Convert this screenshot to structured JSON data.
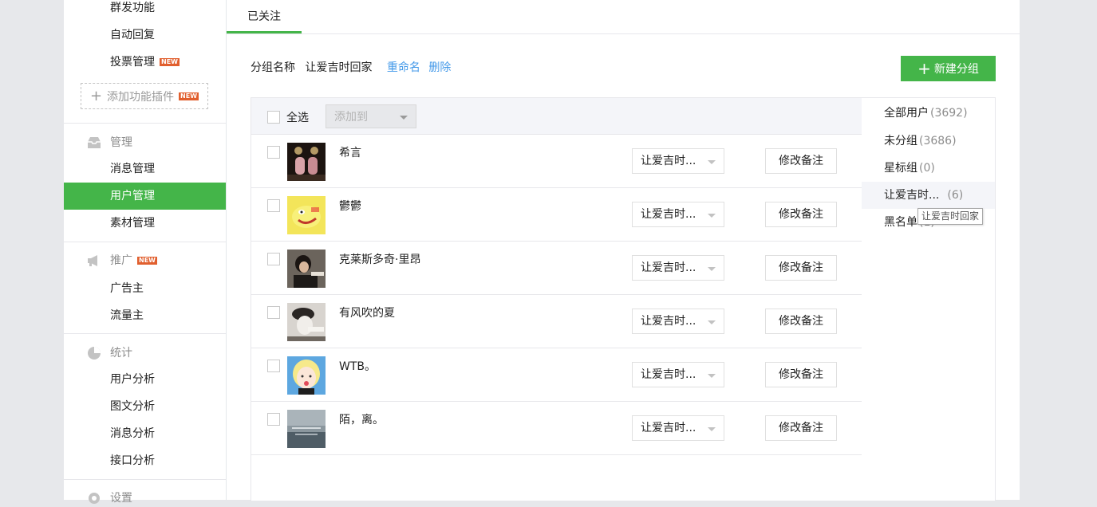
{
  "sidebar": {
    "items_top": [
      {
        "label": "群发功能"
      },
      {
        "label": "自动回复"
      },
      {
        "label": "投票管理",
        "badge": "NEW"
      }
    ],
    "add_plugin": {
      "label": "添加功能插件",
      "badge": "NEW"
    },
    "manage": {
      "title": "管理",
      "items": [
        "消息管理",
        "用户管理",
        "素材管理"
      ],
      "active": "用户管理"
    },
    "promote": {
      "title": "推广",
      "badge": "NEW",
      "items": [
        "广告主",
        "流量主"
      ]
    },
    "stats": {
      "title": "统计",
      "items": [
        "用户分析",
        "图文分析",
        "消息分析",
        "接口分析"
      ]
    },
    "settings": {
      "title": "设置"
    }
  },
  "main": {
    "tab": "已关注",
    "group": {
      "label": "分组名称",
      "name": "让爱吉时回家",
      "rename": "重命名",
      "delete": "删除"
    },
    "new_group": "新建分组",
    "table": {
      "select_all": "全选",
      "add_to": "添加到",
      "rows": [
        {
          "name": "希言",
          "group": "让爱吉时...",
          "remark": "修改备注"
        },
        {
          "name": "鬱鬱",
          "group": "让爱吉时...",
          "remark": "修改备注"
        },
        {
          "name": "克莱斯多奇·里昂",
          "group": "让爱吉时...",
          "remark": "修改备注"
        },
        {
          "name": "有风吹的夏",
          "group": "让爱吉时...",
          "remark": "修改备注"
        },
        {
          "name": "WTB。",
          "group": "让爱吉时...",
          "remark": "修改备注"
        },
        {
          "name": "陌，离。",
          "group": "让爱吉时...",
          "remark": "修改备注"
        }
      ]
    },
    "groups": [
      {
        "name": "全部用户",
        "count": "(3692)"
      },
      {
        "name": "未分组",
        "count": "(3686)"
      },
      {
        "name": "星标组",
        "count": "(0)"
      },
      {
        "name": "让爱吉时...",
        "count": "(6)"
      },
      {
        "name": "黑名单",
        "count": "(1)"
      }
    ],
    "tooltip": "让爱吉时回家"
  },
  "colors": {
    "accent": "#44b549",
    "link": "#459ae9",
    "badge": "#e15f2e"
  }
}
